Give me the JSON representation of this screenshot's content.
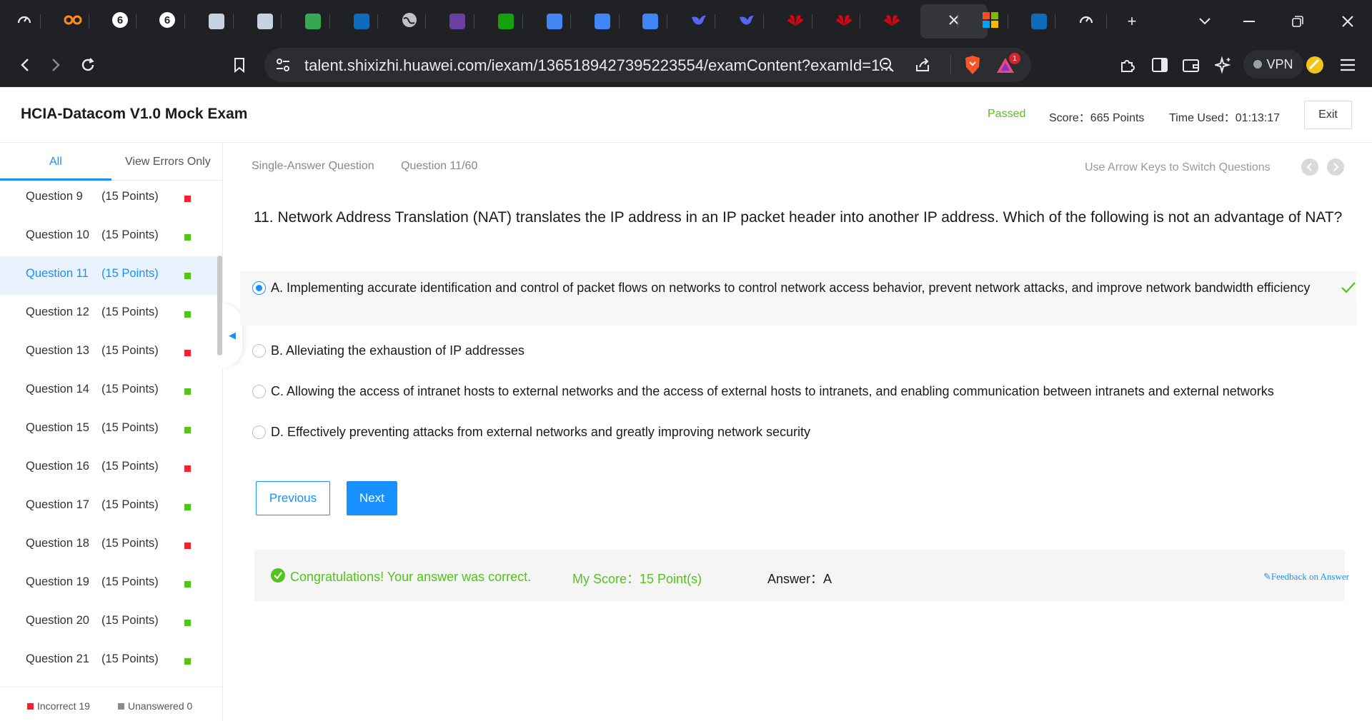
{
  "browser": {
    "url": "talent.shixizhi.huawei.com/iexam/1365189427395223554/examContent?examId=1...",
    "vpn_label": "VPN",
    "notification_count": "1",
    "tabs": [
      {
        "icon": "gauge-icon",
        "color": "#e8eaed"
      },
      {
        "icon": "infinity-icon",
        "color": "#ff8c1a"
      },
      {
        "icon": "number-6-icon",
        "color": "#ffffff"
      },
      {
        "icon": "number-6-icon",
        "color": "#ffffff"
      },
      {
        "icon": "robot-icon",
        "color": "#c7d2e0"
      },
      {
        "icon": "robot-icon",
        "color": "#c7d2e0"
      },
      {
        "icon": "meet-icon",
        "color": "#34a853"
      },
      {
        "icon": "outlook-icon",
        "color": "#0f6cbd"
      },
      {
        "icon": "globe-icon",
        "color": "#bdc1c6"
      },
      {
        "icon": "crest-icon",
        "color": "#6b3fa0"
      },
      {
        "icon": "forms-icon",
        "color": "#13a10e"
      },
      {
        "icon": "docs-icon",
        "color": "#4285f4"
      },
      {
        "icon": "docs-icon",
        "color": "#4285f4"
      },
      {
        "icon": "docs-icon",
        "color": "#4285f4"
      },
      {
        "icon": "bird-icon",
        "color": "#5865f2"
      },
      {
        "icon": "bird-icon",
        "color": "#5865f2"
      },
      {
        "icon": "huawei-icon",
        "color": "#e60012"
      },
      {
        "icon": "huawei-icon",
        "color": "#e60012"
      },
      {
        "icon": "huawei-icon",
        "color": "#e60012"
      },
      {
        "icon": "close-icon",
        "color": "#e8eaed"
      },
      {
        "icon": "microsoft-icon",
        "color": "#f25022"
      },
      {
        "icon": "outlook-icon",
        "color": "#0f6cbd"
      },
      {
        "icon": "gauge-icon",
        "color": "#e8eaed"
      }
    ]
  },
  "header": {
    "title": "HCIA-Datacom V1.0 Mock Exam",
    "status": "Passed",
    "score": "Score：665 Points",
    "time_used": "Time Used：01:13:17",
    "exit_label": "Exit"
  },
  "sidebar": {
    "tabs": [
      {
        "label": "All",
        "active": true
      },
      {
        "label": "View Errors Only",
        "active": false
      }
    ],
    "questions": [
      {
        "label": "Question 9",
        "points": "(15 Points)",
        "status": "incorrect",
        "current": false
      },
      {
        "label": "Question 10",
        "points": "(15 Points)",
        "status": "correct",
        "current": false
      },
      {
        "label": "Question 11",
        "points": "(15 Points)",
        "status": "correct",
        "current": true
      },
      {
        "label": "Question 12",
        "points": "(15 Points)",
        "status": "correct",
        "current": false
      },
      {
        "label": "Question 13",
        "points": "(15 Points)",
        "status": "incorrect",
        "current": false
      },
      {
        "label": "Question 14",
        "points": "(15 Points)",
        "status": "correct",
        "current": false
      },
      {
        "label": "Question 15",
        "points": "(15 Points)",
        "status": "correct",
        "current": false
      },
      {
        "label": "Question 16",
        "points": "(15 Points)",
        "status": "incorrect",
        "current": false
      },
      {
        "label": "Question 17",
        "points": "(15 Points)",
        "status": "correct",
        "current": false
      },
      {
        "label": "Question 18",
        "points": "(15 Points)",
        "status": "incorrect",
        "current": false
      },
      {
        "label": "Question 19",
        "points": "(15 Points)",
        "status": "correct",
        "current": false
      },
      {
        "label": "Question 20",
        "points": "(15 Points)",
        "status": "correct",
        "current": false
      },
      {
        "label": "Question 21",
        "points": "(15 Points)",
        "status": "correct",
        "current": false
      }
    ],
    "legend": {
      "incorrect": "Incorrect 19",
      "unanswered": "Unanswered 0"
    }
  },
  "main": {
    "question_type": "Single-Answer Question",
    "question_number": "Question 11/60",
    "nav_hint": "Use Arrow Keys to Switch Questions",
    "question_text": "11. Network Address Translation (NAT) translates the IP address in an IP packet header into another IP address. Which of the following is not an advantage of NAT?",
    "options": [
      {
        "text": "A. Implementing accurate identification and control of packet flows on networks to control network access behavior, prevent network attacks, and improve network bandwidth efficiency",
        "selected": true,
        "correct": true
      },
      {
        "text": "B. Alleviating the exhaustion of IP addresses",
        "selected": false,
        "correct": false
      },
      {
        "text": "C. Allowing the access of intranet hosts to external networks and the access of external hosts to intranets, and enabling communication between intranets and external networks",
        "selected": false,
        "correct": false
      },
      {
        "text": "D. Effectively preventing attacks from external networks and greatly improving network security",
        "selected": false,
        "correct": false
      }
    ],
    "previous_label": "Previous",
    "next_label": "Next",
    "result": {
      "message": "Congratulations! Your answer was correct.",
      "my_score": "My Score：15 Point(s)",
      "answer": "Answer：A",
      "feedback": "Feedback on Answer"
    }
  },
  "colors": {
    "accent": "#1890ff",
    "correct": "#52c41a",
    "incorrect": "#f5222d",
    "unanswered": "#8c8c8c"
  }
}
